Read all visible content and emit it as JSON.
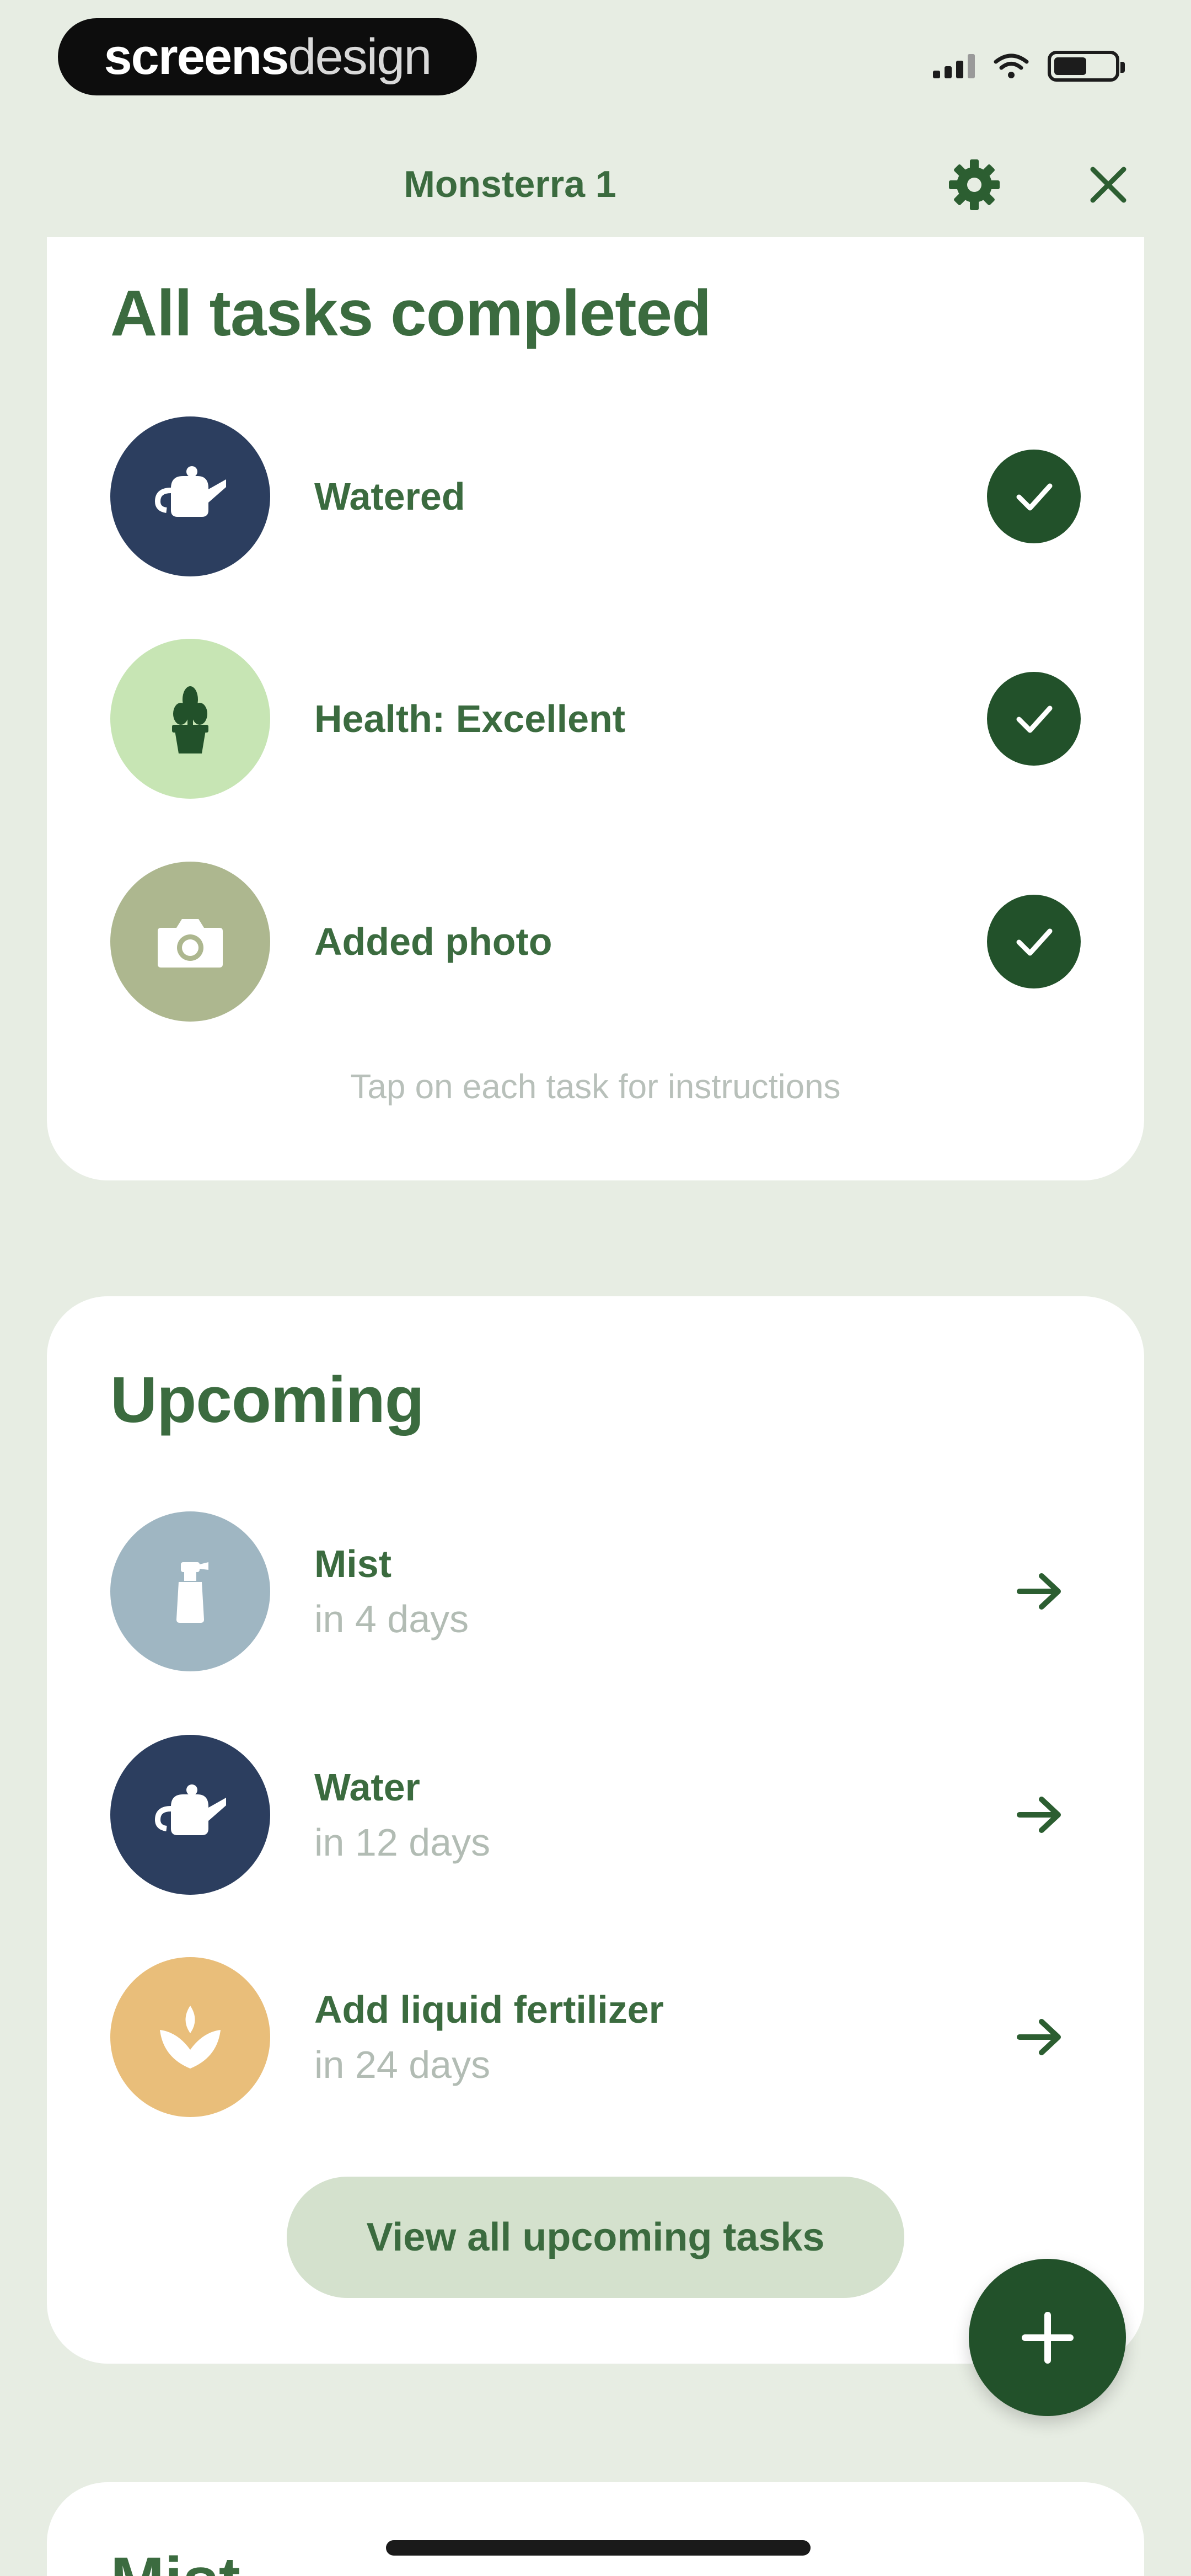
{
  "status_bar": {
    "brand_bold": "screens",
    "brand_light": "design"
  },
  "header": {
    "title": "Monsterra 1",
    "settings_icon": "gear-icon",
    "close_icon": "close-icon"
  },
  "completed": {
    "title": "All tasks completed",
    "tasks": [
      {
        "label": "Watered",
        "icon": "watering-can-icon",
        "color": "#2c3e5f"
      },
      {
        "label": "Health: Excellent",
        "icon": "plant-pot-icon",
        "color": "#c7e5b4"
      },
      {
        "label": "Added photo",
        "icon": "camera-icon",
        "color": "#adb78f"
      }
    ],
    "hint": "Tap on each task for instructions"
  },
  "upcoming": {
    "title": "Upcoming",
    "tasks": [
      {
        "label": "Mist",
        "when": "in 4 days",
        "icon": "spray-bottle-icon",
        "color": "#9fb6c2"
      },
      {
        "label": "Water",
        "when": "in 12 days",
        "icon": "watering-can-icon",
        "color": "#2c3e5f"
      },
      {
        "label": "Add liquid fertilizer",
        "when": "in 24 days",
        "icon": "fertilizer-icon",
        "color": "#e9be7a"
      }
    ],
    "view_all": "View all upcoming tasks"
  },
  "next_section": {
    "title_partial": "Mist"
  },
  "colors": {
    "accent_dark": "#22512a",
    "text_green": "#3b6b3f",
    "background": "#e7ede3"
  }
}
